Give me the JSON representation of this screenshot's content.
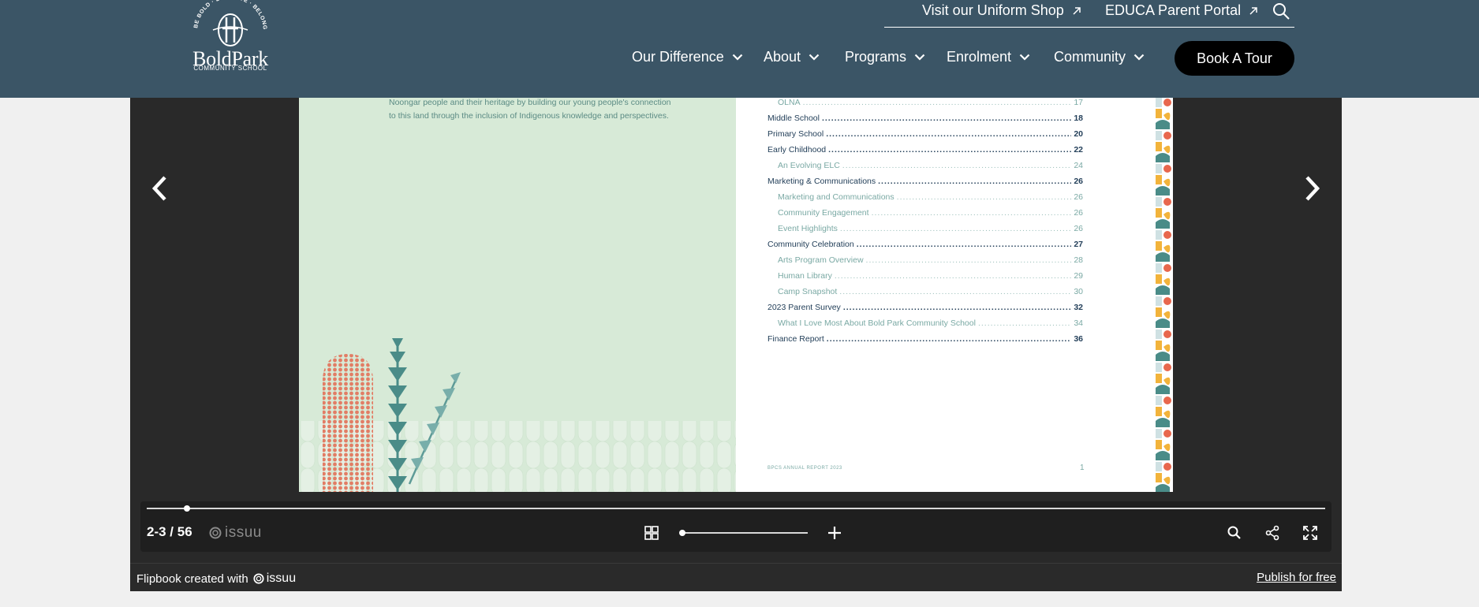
{
  "header": {
    "logo": {
      "motto": "BE BOLD · BE BRAVE · BELONG",
      "name": "BoldPark",
      "sub": "COMMUNITY SCHOOL"
    },
    "top_links": [
      {
        "label": "Visit our Uniform Shop",
        "icon": "external-link-icon"
      },
      {
        "label": "EDUCA Parent Portal",
        "icon": "external-link-icon"
      }
    ],
    "search_icon": "search-icon",
    "nav": [
      {
        "label": "Our Difference"
      },
      {
        "label": "About"
      },
      {
        "label": "Programs"
      },
      {
        "label": "Enrolment"
      },
      {
        "label": "Community"
      }
    ],
    "book_tour": "Book A Tour",
    "colors": {
      "bg": "#3b5566",
      "button": "#000000"
    }
  },
  "viewer": {
    "left_page": {
      "lines": [
        "Noongar people and their heritage by building our young people's connection",
        "to this land through the inclusion of Indigenous knowledge and perspectives."
      ]
    },
    "right_page": {
      "toc": [
        {
          "label": "OLNA",
          "page": "17",
          "level": "sub"
        },
        {
          "label": "Middle School",
          "page": "18",
          "level": "main"
        },
        {
          "label": "Primary School",
          "page": "20",
          "level": "main"
        },
        {
          "label": "Early Childhood",
          "page": "22",
          "level": "main"
        },
        {
          "label": "An Evolving ELC",
          "page": "24",
          "level": "sub"
        },
        {
          "label": "Marketing & Communications",
          "page": "26",
          "level": "main"
        },
        {
          "label": "Marketing and Communications",
          "page": "26",
          "level": "sub"
        },
        {
          "label": "Community Engagement",
          "page": "26",
          "level": "sub"
        },
        {
          "label": "Event Highlights",
          "page": "26",
          "level": "sub"
        },
        {
          "label": "Community Celebration",
          "page": "27",
          "level": "main"
        },
        {
          "label": "Arts Program Overview",
          "page": "28",
          "level": "sub"
        },
        {
          "label": "Human Library",
          "page": "29",
          "level": "sub"
        },
        {
          "label": "Camp Snapshot",
          "page": "30",
          "level": "sub"
        },
        {
          "label": "2023 Parent Survey",
          "page": "32",
          "level": "main"
        },
        {
          "label": "What I Love Most About Bold Park Community School",
          "page": "34",
          "level": "sub"
        },
        {
          "label": "Finance Report",
          "page": "36",
          "level": "main"
        }
      ],
      "footer_text": "BPCS ANNUAL REPORT 2023",
      "footer_page": "1"
    },
    "controls": {
      "page_counter": "2-3 / 56",
      "brand": "issuu",
      "progress": 0.034,
      "zoom": 0.0
    },
    "bottom_bar": {
      "created_text": "Flipbook created with",
      "brand": "issuu",
      "publish": "Publish for free"
    }
  }
}
